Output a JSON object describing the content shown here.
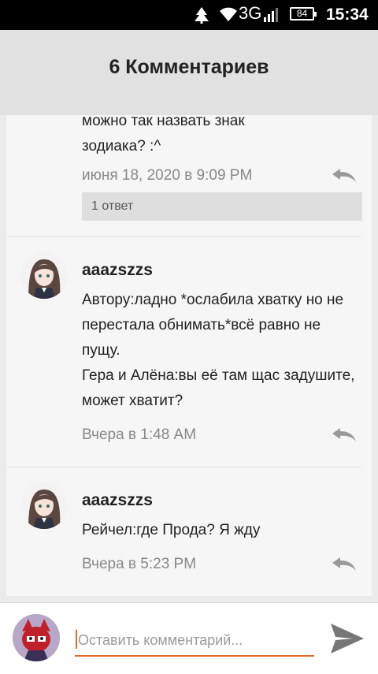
{
  "status_bar": {
    "network": "3G",
    "battery": "84",
    "time": "15:34"
  },
  "header": {
    "title": "6 Комментариев"
  },
  "comments": [
    {
      "text": "можно так назвать знак\nзодиака? :^",
      "timestamp": "июня 18, 2020 в 9:09 PM",
      "replies_label": "1 ответ"
    },
    {
      "author": "aaazszzs",
      "text": "Автору:ладно *ослабила хватку но не перестала обнимать*всё равно не пущу.\nГера и Алёна:вы её там щас задушите, может хватит?",
      "timestamp": "Вчера в 1:48 AM"
    },
    {
      "author": "aaazszzs",
      "text": "Рейчел:где Прода? Я жду",
      "timestamp": "Вчера в 5:23 PM"
    }
  ],
  "composer": {
    "placeholder": "Оставить комментарий..."
  }
}
